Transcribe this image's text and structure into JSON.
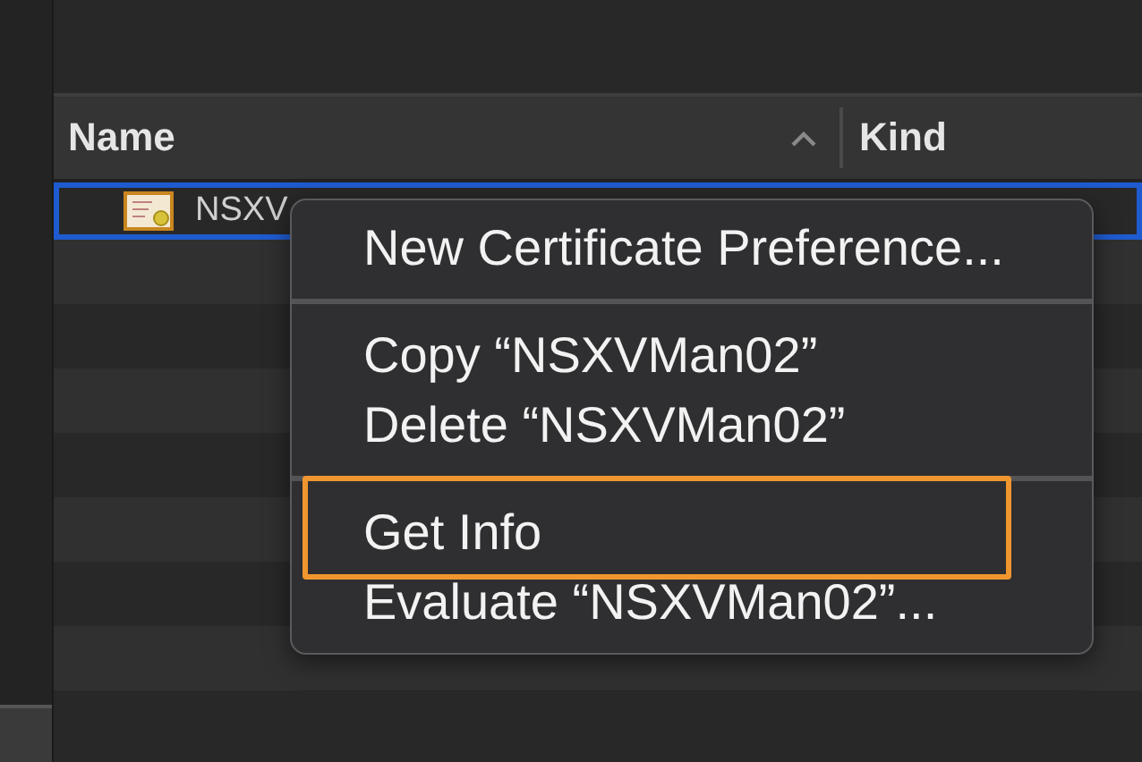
{
  "table": {
    "columns": [
      {
        "label": "Name",
        "sorted": true
      },
      {
        "label": "Kind",
        "sorted": false
      }
    ],
    "rows": [
      {
        "name": "NSXV",
        "selected": true
      }
    ]
  },
  "context_menu": {
    "items": [
      {
        "kind": "item",
        "label": "New Certificate Preference...",
        "annotated": false
      },
      {
        "kind": "separator"
      },
      {
        "kind": "item",
        "label": "Copy “NSXVMan02”",
        "annotated": false
      },
      {
        "kind": "item",
        "label": "Delete “NSXVMan02”",
        "annotated": false
      },
      {
        "kind": "separator"
      },
      {
        "kind": "item",
        "label": "Get Info",
        "annotated": true
      },
      {
        "kind": "item",
        "label": "Evaluate “NSXVMan02”...",
        "annotated": false
      }
    ]
  }
}
